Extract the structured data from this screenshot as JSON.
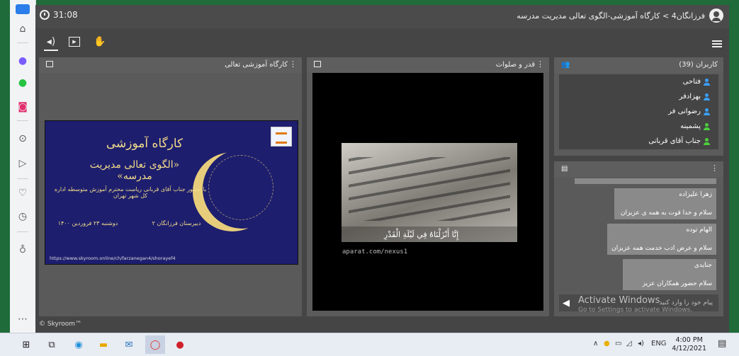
{
  "app": {
    "timer": "31:08",
    "room_title": "فرزانگان4 > کارگاه آموزشی-الگوی تعالی مدیریت مدرسه",
    "footer": "© Skyroom™"
  },
  "panels": {
    "slide_panel_title": "کارگاه آموزشی تعالی",
    "video_panel_title": "قدر و صلوات",
    "users_panel_title": "کاربران (39)"
  },
  "slide": {
    "title": "کارگاه آموزشی",
    "subtitle": "«الگوی تعالی مدیریت مدرسه»",
    "line3": "با حضور جناب آقای قربانی ریاست محترم آموزش متوسطه اداره کل شهر تهران",
    "school": "دبیرستان فرزانگان ۲",
    "date": "دوشنبه ۲۳ فروردین ۱۴۰۰",
    "url": "https://www.skyroom.online/ch/farzanegan4/shorayef4"
  },
  "video": {
    "caption": "إِنَّا أَنْزَلْنَاهُ فِي لَيْلَةِ الْقَدْرِ",
    "source": "aparat.com/nexus1"
  },
  "users": [
    {
      "name": "فتاحی",
      "color": "#3aa0ff"
    },
    {
      "name": "بهزادفر",
      "color": "#3aa0ff"
    },
    {
      "name": "رضوانی فر",
      "color": "#3aa0ff"
    },
    {
      "name": "پشمینه",
      "color": "#4ccf3b"
    },
    {
      "name": "جناب آقای قربانی",
      "color": "#4ccf3b"
    }
  ],
  "chat": {
    "messages": [
      {
        "name": "زهرا علیزاده",
        "text": "سلام و خدا قوت به همه ی عزیزان"
      },
      {
        "name": "الهام توده",
        "text": "سلام و عرض ادب خدمت همه عزیزان"
      },
      {
        "name": "جنایدی",
        "text": "سلام حضور همکاران عزیز"
      }
    ],
    "input_placeholder": "پیام خود را وارد کنید",
    "activate_title": "Activate Windows",
    "activate_sub": "Go to Settings to activate Windows."
  },
  "taskbar": {
    "language": "ENG",
    "time": "4:00 PM",
    "date": "4/12/2021"
  },
  "colors": {
    "app_bg": "#454545",
    "panel_bg": "#5b5b5b",
    "frame_green": "#1f6b3a",
    "slide_bg": "#1d1e6e",
    "slide_gold": "#f3dc8a"
  }
}
